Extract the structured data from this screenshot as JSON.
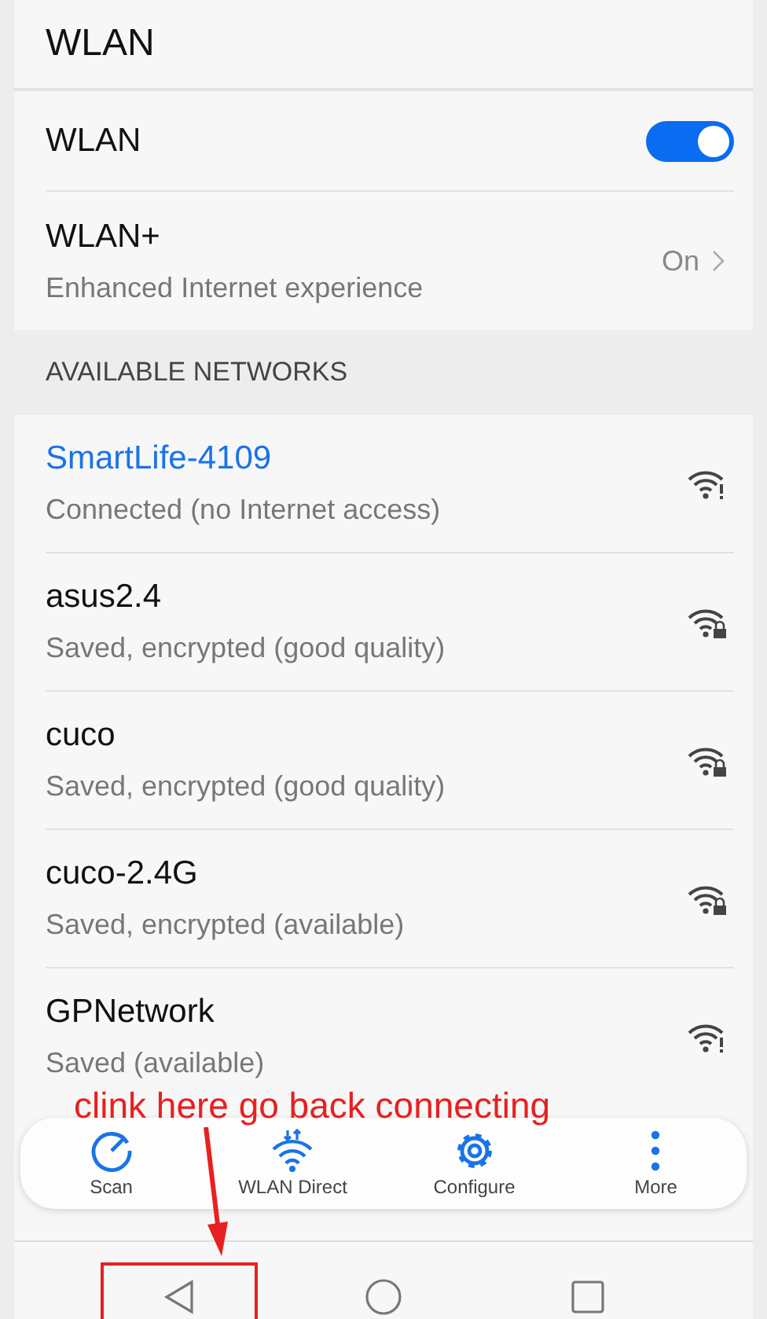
{
  "header": {
    "title": "WLAN"
  },
  "settings": [
    {
      "kind": "toggle",
      "label": "WLAN",
      "on": true
    },
    {
      "kind": "link",
      "label": "WLAN+",
      "subtitle": "Enhanced Internet experience",
      "value": "On"
    }
  ],
  "section": {
    "title": "AVAILABLE NETWORKS"
  },
  "networks": [
    {
      "name": "SmartLife-4109",
      "status": "Connected (no Internet access)",
      "connected": true,
      "secured": false
    },
    {
      "name": "asus2.4",
      "status": "Saved, encrypted (good quality)",
      "connected": false,
      "secured": true
    },
    {
      "name": "cuco",
      "status": "Saved, encrypted (good quality)",
      "connected": false,
      "secured": true
    },
    {
      "name": "cuco-2.4G",
      "status": "Saved, encrypted (available)",
      "connected": false,
      "secured": true
    },
    {
      "name": "GPNetwork",
      "status": "Saved (available)",
      "connected": false,
      "secured": false
    }
  ],
  "toolbar": [
    {
      "kind": "scan",
      "label": "Scan"
    },
    {
      "kind": "direct",
      "label": "WLAN Direct"
    },
    {
      "kind": "configure",
      "label": "Configure"
    },
    {
      "kind": "more",
      "label": "More"
    }
  ],
  "nav": [
    {
      "kind": "back"
    },
    {
      "kind": "home"
    },
    {
      "kind": "recents"
    }
  ],
  "annotation": {
    "text": "clink here go back connecting"
  }
}
